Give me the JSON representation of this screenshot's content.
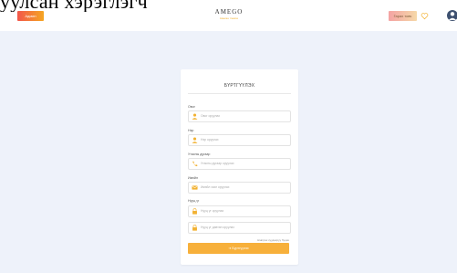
{
  "caption_overlay": "уулсан хэрэглэгч",
  "header": {
    "admin_label": "Админ",
    "brand_name": "AMEGO",
    "brand_sub": "Амьтан тэжээх",
    "logout_label": "Гарах товч"
  },
  "form": {
    "title": "БҮРТГҮҮЛЭХ",
    "fields": [
      {
        "label": "Овог",
        "placeholder": "Овог оруулах",
        "icon": "user-icon"
      },
      {
        "label": "Нэр",
        "placeholder": "Нэр оруулах",
        "icon": "user-icon"
      },
      {
        "label": "Утасны дугаар",
        "placeholder": "Утасны дугаар оруулах",
        "icon": "phone-icon"
      },
      {
        "label": "Имэйл",
        "placeholder": "Имэйл хаяг оруулах",
        "icon": "mail-icon"
      },
      {
        "label": "Нууц үг",
        "placeholder": "Нууц үг оруулах",
        "icon": "lock-icon"
      },
      {
        "label": "",
        "placeholder": "Нууц үг давтан оруулах",
        "icon": "lock-icon"
      }
    ],
    "forgot_label": "Нэвтрэх хуудасруу буцах",
    "submit_label": "Бүртгүүлэх"
  },
  "colors": {
    "accent": "#f7b03b",
    "background": "#eef2fa"
  }
}
